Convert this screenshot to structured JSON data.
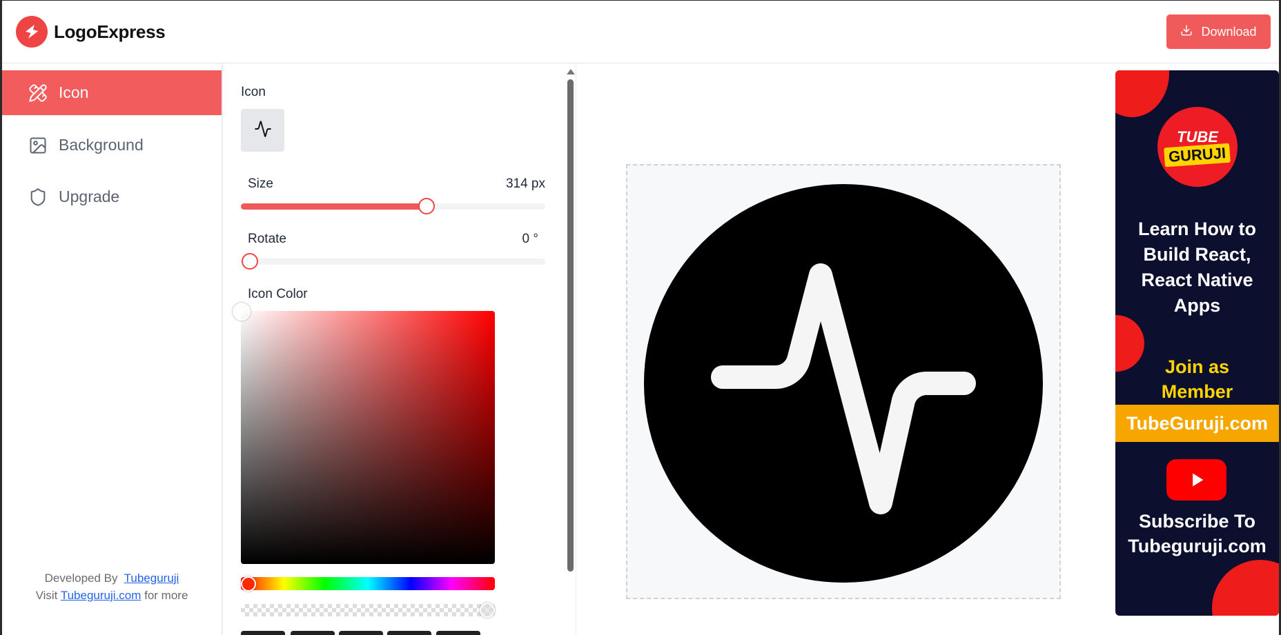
{
  "app": {
    "name": "LogoExpress",
    "download_label": "Download"
  },
  "sidebar": {
    "items": [
      {
        "label": "Icon",
        "icon": "pencil-ruler-icon",
        "active": true
      },
      {
        "label": "Background",
        "icon": "image-icon",
        "active": false
      },
      {
        "label": "Upgrade",
        "icon": "shield-icon",
        "active": false
      }
    ],
    "credits": {
      "developed_by": "Developed By",
      "developer_link": "Tubeguruji",
      "visit": "Visit",
      "site_link": "Tubeguruji.com",
      "for_more": "for more"
    }
  },
  "controls": {
    "icon_label": "Icon",
    "selected_icon": "activity-icon",
    "size": {
      "label": "Size",
      "value": 314,
      "display": "314 px",
      "fill_fraction": 0.61
    },
    "rotate": {
      "label": "Rotate",
      "value": 0,
      "display": "0 °",
      "fill_fraction": 0.03
    },
    "icon_color": {
      "label": "Icon Color",
      "hue_color": "#ff0000",
      "selected_color": "#ffffff"
    }
  },
  "preview": {
    "background_color": "#000000",
    "icon_color": "#f5f5f5",
    "icon": "activity-icon"
  },
  "ad": {
    "badge_top": "TUBE",
    "badge_bottom": "GURUJI",
    "headline": "Learn How to Build React, React Native Apps",
    "join": "Join as Member",
    "site": "TubeGuruji.com",
    "subscribe": "Subscribe To Tubeguruji.com",
    "colors": {
      "bg": "#0c0f2e",
      "accent": "#ef1c1c",
      "yellow": "#ffd400",
      "band": "#f7a600"
    }
  },
  "colors": {
    "brand": "#ef4444",
    "active_nav": "#f25c5c"
  }
}
